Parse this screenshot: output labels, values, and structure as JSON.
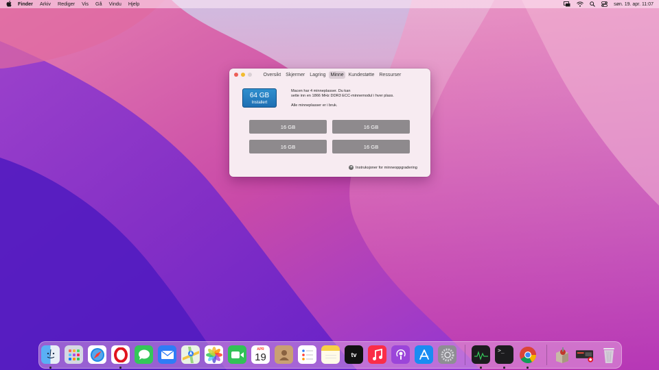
{
  "menubar": {
    "items": [
      "Finder",
      "Arkiv",
      "Rediger",
      "Vis",
      "Gå",
      "Vindu",
      "Hjelp"
    ],
    "clock": "søn. 19. apr. 11:07",
    "status_icons": [
      "screen-mirroring-icon",
      "wifi-icon",
      "spotlight-search-icon",
      "control-center-icon"
    ]
  },
  "window": {
    "tabs": [
      "Oversikt",
      "Skjermer",
      "Lagring",
      "Minne",
      "Kundestøtte",
      "Ressurser"
    ],
    "active_tab": "Minne",
    "memory": {
      "installed_amount": "64 GB",
      "installed_label": "Installert",
      "description_line1": "Macen har 4 minneplasser. Du kan",
      "description_line2": "sette inn en 1866 MHz DDR3 ECC-minnemodul i hver plass.",
      "slots_status": "Alle minneplasser er i bruk.",
      "slots": [
        "16 GB",
        "16 GB",
        "16 GB",
        "16 GB"
      ],
      "upgrade_link": "Instruksjoner for minneoppgradering"
    }
  },
  "dock": {
    "calendar_month": "APR",
    "calendar_day": "19",
    "apps": [
      "Finder",
      "Launchpad",
      "Safari",
      "Opera",
      "Meldinger",
      "Mail",
      "Kart",
      "Bilder",
      "FaceTime",
      "Kalender",
      "Kontakter",
      "Påminnelser",
      "Notater",
      "Apple TV",
      "Musikk",
      "Podkaster",
      "App Store",
      "Systemvalg",
      "Aktivitetsmonitor",
      "Terminal",
      "Chrome",
      "Installasjonsprogram",
      "Vindu",
      "Papirkurv"
    ],
    "colors": {
      "safari": "#1e88e5",
      "opera": "#e0141e",
      "messages": "#34c759",
      "mail": "#2f7cf6",
      "facetime": "#32c257",
      "music": "#fa2d48",
      "podcasts": "#9b45d9",
      "appstore": "#1a8cf2"
    }
  }
}
